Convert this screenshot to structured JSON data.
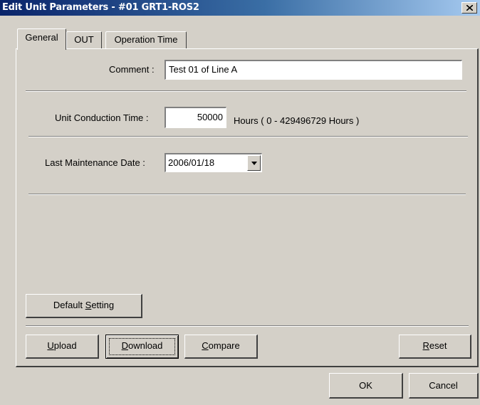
{
  "window": {
    "title": "Edit Unit Parameters - #01 GRT1-ROS2",
    "close_glyph": "close-icon"
  },
  "tabs": [
    {
      "label": "General",
      "active": true
    },
    {
      "label": "OUT",
      "active": false
    },
    {
      "label": "Operation Time",
      "active": false
    }
  ],
  "general": {
    "comment_label": "Comment :",
    "comment_value": "Test 01 of Line A",
    "conduction_label": "Unit Conduction Time :",
    "conduction_value": "50000",
    "conduction_unit": "Hours ( 0 - 429496729 Hours )",
    "maintenance_label": "Last Maintenance Date :",
    "maintenance_value": "2006/01/18",
    "default_setting": {
      "pre": "Default ",
      "key": "S",
      "post": "etting"
    }
  },
  "actions": {
    "upload": {
      "pre": "",
      "key": "U",
      "post": "pload"
    },
    "download": {
      "pre": "",
      "key": "D",
      "post": "ownload"
    },
    "compare": {
      "pre": "",
      "key": "C",
      "post": "ompare"
    },
    "reset": {
      "pre": "",
      "key": "R",
      "post": "eset"
    }
  },
  "footer": {
    "ok": "OK",
    "cancel": "Cancel"
  },
  "colors": {
    "face": "#d4d0c8",
    "title_start": "#0a246a",
    "title_end": "#a6caf0"
  }
}
